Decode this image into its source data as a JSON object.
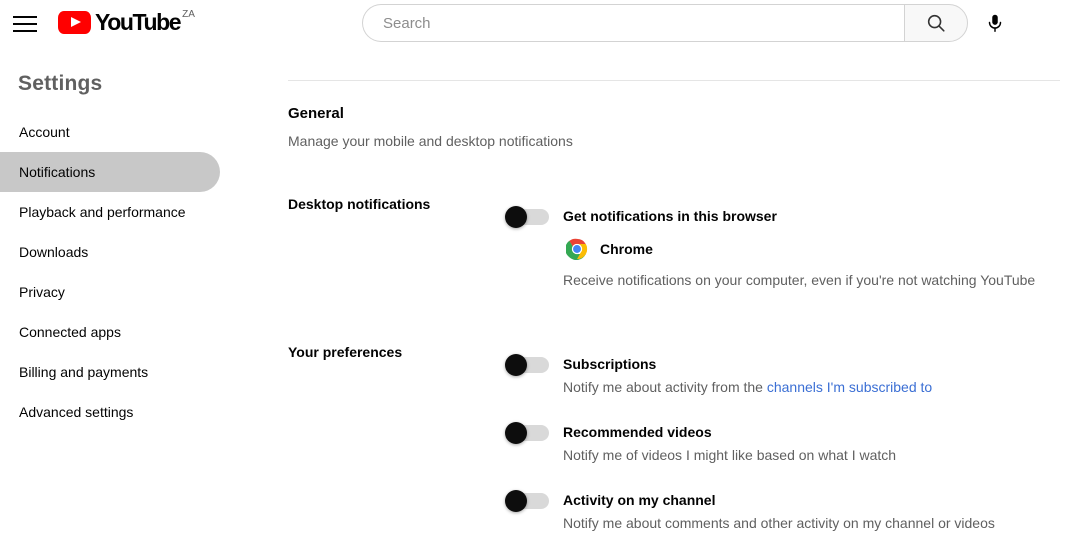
{
  "masthead": {
    "menu_icon": "hamburger-menu-icon",
    "logo_text": "YouTube",
    "logo_country": "ZA",
    "search_placeholder": "Search",
    "search_value": "",
    "search_icon": "search-icon",
    "mic_icon": "microphone-icon"
  },
  "sidebar": {
    "title": "Settings",
    "items": [
      {
        "label": "Account",
        "selected": false
      },
      {
        "label": "Notifications",
        "selected": true
      },
      {
        "label": "Playback and performance",
        "selected": false
      },
      {
        "label": "Downloads",
        "selected": false
      },
      {
        "label": "Privacy",
        "selected": false
      },
      {
        "label": "Connected apps",
        "selected": false
      },
      {
        "label": "Billing and payments",
        "selected": false
      },
      {
        "label": "Advanced settings",
        "selected": false
      }
    ]
  },
  "main": {
    "section_title": "General",
    "section_subtitle": "Manage your mobile and desktop notifications",
    "desktop": {
      "label": "Desktop notifications",
      "option_title": "Get notifications in this browser",
      "toggle_state": "off",
      "browser_icon": "chrome-icon",
      "browser_name": "Chrome",
      "option_desc": "Receive notifications on your computer, even if you're not watching YouTube"
    },
    "preferences": {
      "label": "Your preferences",
      "items": [
        {
          "title": "Subscriptions",
          "desc_before": "Notify me about activity from the ",
          "link_text": "channels I'm subscribed to",
          "desc_after": "",
          "toggle_state": "off"
        },
        {
          "title": "Recommended videos",
          "desc_before": "Notify me of videos I might like based on what I watch",
          "link_text": "",
          "desc_after": "",
          "toggle_state": "off"
        },
        {
          "title": "Activity on my channel",
          "desc_before": "Notify me about comments and other activity on my channel or videos",
          "link_text": "",
          "desc_after": "",
          "toggle_state": "off"
        }
      ]
    }
  },
  "colors": {
    "brand_red": "#ff0000",
    "link_blue": "#3b6fd4",
    "selected_bg": "#c8c8c8",
    "secondary_text": "#606060"
  }
}
